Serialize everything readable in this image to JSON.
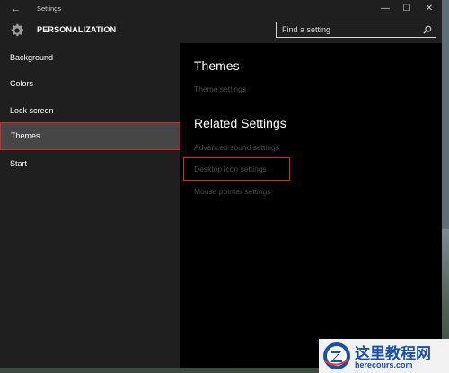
{
  "window": {
    "title": "Settings",
    "controls": {
      "minimize": "—",
      "maximize": "☐",
      "close": "✕"
    }
  },
  "header": {
    "page_title": "PERSONALIZATION",
    "search": {
      "placeholder": "Find a setting",
      "value": ""
    }
  },
  "sidebar": {
    "items": [
      {
        "label": "Background",
        "active": false
      },
      {
        "label": "Colors",
        "active": false
      },
      {
        "label": "Lock screen",
        "active": false
      },
      {
        "label": "Themes",
        "active": true
      },
      {
        "label": "Start",
        "active": false
      }
    ]
  },
  "content": {
    "themes_heading": "Themes",
    "theme_settings_link": "Theme settings",
    "related_heading": "Related Settings",
    "related_links": [
      "Advanced sound settings",
      "Desktop icon settings",
      "Mouse pointer settings"
    ]
  },
  "watermark": {
    "cn_text": "这里教程网",
    "en_text": "herecours.com"
  },
  "colors": {
    "accent_highlight": "#e02424",
    "content_bg": "#000000",
    "sidebar_bg": "#1f1f1f",
    "link_dim": "#4a4a4a"
  }
}
